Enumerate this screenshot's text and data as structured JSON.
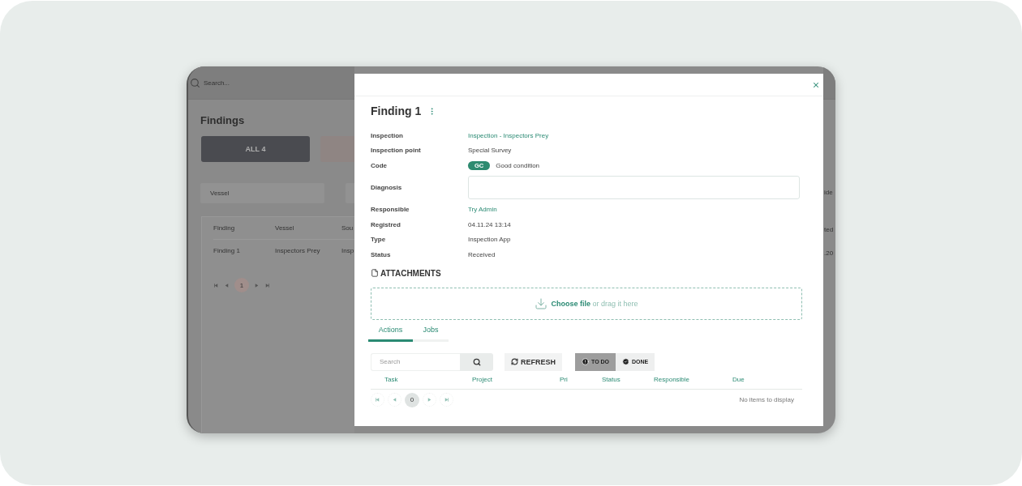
{
  "background_app": {
    "search": {
      "placeholder": "Search..."
    },
    "title": "Findings",
    "filter_buttons": [
      {
        "label": "ALL 4",
        "selected": true
      }
    ],
    "filters": [
      {
        "placeholder": "Vessel"
      }
    ],
    "table": {
      "columns": [
        "Finding",
        "Vessel",
        "Sou"
      ],
      "rows": [
        [
          "Finding 1",
          "Inspectors Prey",
          "Insp"
        ]
      ]
    },
    "pagination": {
      "page": "1"
    },
    "right_edge_fragments": [
      "ide",
      "ted",
      ".20"
    ]
  },
  "modal": {
    "title": "Finding 1",
    "fields": [
      {
        "label": "Inspection",
        "kind": "link",
        "value": "Inspection - Inspectors Prey"
      },
      {
        "label": "Inspection point",
        "kind": "text",
        "value": "Special Survey"
      },
      {
        "label": "Code",
        "kind": "code",
        "badge": "GC",
        "value": "Good condition"
      },
      {
        "label": "Diagnosis",
        "kind": "input"
      },
      {
        "label": "Responsible",
        "kind": "link",
        "value": "Try Admin"
      },
      {
        "label": "Registred",
        "kind": "text",
        "value": "04.11.24 13:14"
      },
      {
        "label": "Type",
        "kind": "text",
        "value": "Inspection App"
      },
      {
        "label": "Status",
        "kind": "text",
        "value": "Received"
      }
    ],
    "attachments": {
      "title": "ATTACHMENTS",
      "choose_file": "Choose file",
      "hint": "or drag it here"
    },
    "tabs": [
      {
        "label": "Actions",
        "selected": true
      },
      {
        "label": "Jobs",
        "selected": false
      }
    ],
    "search": {
      "placeholder": "Search"
    },
    "refresh": "REFRESH",
    "status_toggle": [
      {
        "label": "TO DO",
        "selected": true
      },
      {
        "label": "DONE",
        "selected": false
      }
    ],
    "columns": [
      "Task",
      "Project",
      "Pri",
      "Status",
      "Responsible",
      "Due"
    ],
    "pagination": {
      "page": "0"
    },
    "empty_text": "No items to display"
  }
}
